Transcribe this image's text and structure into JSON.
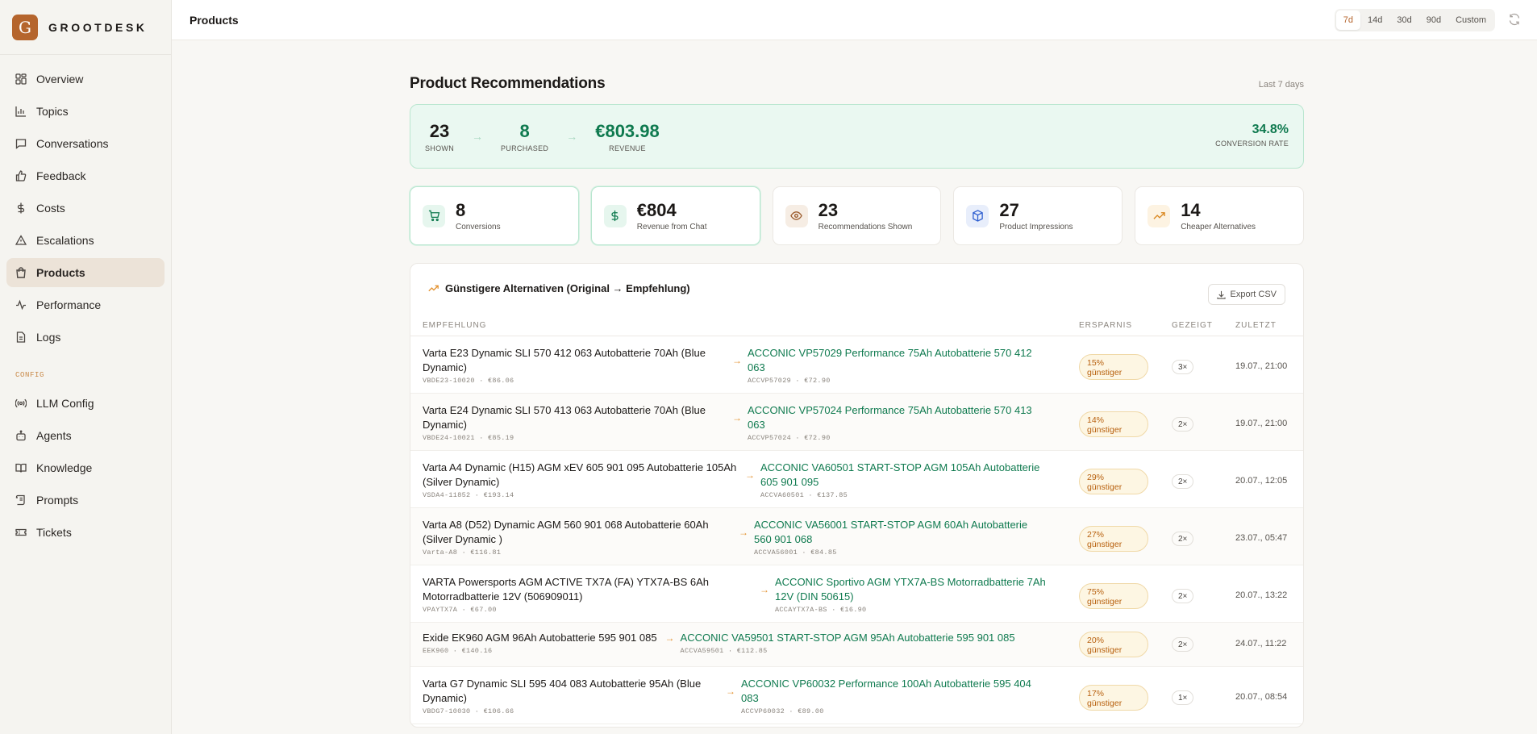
{
  "brand": {
    "logo_letter": "G",
    "name": "GROOTDESK"
  },
  "nav": {
    "items": [
      {
        "label": "Overview",
        "icon": "grid-icon"
      },
      {
        "label": "Topics",
        "icon": "bar-chart-icon"
      },
      {
        "label": "Conversations",
        "icon": "message-icon"
      },
      {
        "label": "Feedback",
        "icon": "thumbs-up-icon"
      },
      {
        "label": "Costs",
        "icon": "dollar-icon"
      },
      {
        "label": "Escalations",
        "icon": "warning-icon"
      },
      {
        "label": "Products",
        "icon": "bag-icon",
        "active": true
      },
      {
        "label": "Performance",
        "icon": "activity-icon"
      },
      {
        "label": "Logs",
        "icon": "file-icon"
      }
    ],
    "config_label": "CONFIG",
    "config_items": [
      {
        "label": "LLM Config",
        "icon": "radio-icon"
      },
      {
        "label": "Agents",
        "icon": "bot-icon"
      },
      {
        "label": "Knowledge",
        "icon": "book-icon"
      },
      {
        "label": "Prompts",
        "icon": "scroll-icon"
      },
      {
        "label": "Tickets",
        "icon": "ticket-icon"
      }
    ]
  },
  "topbar": {
    "title": "Products",
    "ranges": [
      "7d",
      "14d",
      "30d",
      "90d",
      "Custom"
    ],
    "active_range": "7d"
  },
  "page": {
    "title": "Product Recommendations",
    "range_label": "Last 7 days"
  },
  "funnel": {
    "shown": {
      "value": "23",
      "label": "SHOWN"
    },
    "purchased": {
      "value": "8",
      "label": "PURCHASED"
    },
    "revenue": {
      "value": "€803.98",
      "label": "REVENUE"
    },
    "conversion": {
      "value": "34.8%",
      "label": "CONVERSION RATE"
    }
  },
  "kpis": [
    {
      "value": "8",
      "label": "Conversions",
      "icon": "cart-icon",
      "color": "#0f7a4f",
      "bg": "#e6f6ee",
      "highlight": true
    },
    {
      "value": "€804",
      "label": "Revenue from Chat",
      "icon": "dollar-icon",
      "color": "#0f7a4f",
      "bg": "#e6f6ee",
      "highlight": true
    },
    {
      "value": "23",
      "label": "Recommendations Shown",
      "icon": "eye-icon",
      "color": "#9a5a2b",
      "bg": "#f6ede4",
      "highlight": false
    },
    {
      "value": "27",
      "label": "Product Impressions",
      "icon": "box-icon",
      "color": "#2f5fd0",
      "bg": "#e8eefb",
      "highlight": false
    },
    {
      "value": "14",
      "label": "Cheaper Alternatives",
      "icon": "trend-icon",
      "color": "#d9861d",
      "bg": "#fdf3e2",
      "highlight": false
    }
  ],
  "alternatives": {
    "title": "Günstigere Alternativen (Original → Empfehlung)",
    "export_label": "Export CSV",
    "columns": [
      "EMPFEHLUNG",
      "ERSPARNIS",
      "GEZEIGT",
      "ZULETZT"
    ],
    "rows": [
      {
        "orig": "Varta E23 Dynamic SLI 570 412 063 Autobatterie 70Ah (Blue Dynamic)",
        "orig_sub": "VBDE23-10020 · €86.06",
        "rec": "ACCONIC VP57029 Performance 75Ah Autobatterie 570 412 063",
        "rec_sub": "ACCVP57029 · €72.90",
        "pct": "15%",
        "word": "günstiger",
        "seen": "3×",
        "last": "19.07., 21:00"
      },
      {
        "orig": "Varta E24 Dynamic SLI 570 413 063 Autobatterie 70Ah (Blue Dynamic)",
        "orig_sub": "VBDE24-10021 · €85.19",
        "rec": "ACCONIC VP57024 Performance 75Ah Autobatterie 570 413 063",
        "rec_sub": "ACCVP57024 · €72.90",
        "pct": "14%",
        "word": "günstiger",
        "seen": "2×",
        "last": "19.07., 21:00"
      },
      {
        "orig": "Varta A4 Dynamic (H15) AGM xEV 605 901 095 Autobatterie 105Ah (Silver Dynamic)",
        "orig_sub": "VSDA4-11852 · €193.14",
        "rec": "ACCONIC VA60501 START-STOP AGM 105Ah Autobatterie 605 901 095",
        "rec_sub": "ACCVA60501 · €137.85",
        "pct": "29%",
        "word": "günstiger",
        "seen": "2×",
        "last": "20.07., 12:05"
      },
      {
        "orig": "Varta A8 (D52) Dynamic AGM 560 901 068 Autobatterie 60Ah (Silver Dynamic )",
        "orig_sub": "Varta-A8 · €116.81",
        "rec": "ACCONIC VA56001 START-STOP AGM 60Ah Autobatterie 560 901 068",
        "rec_sub": "ACCVA56001 · €84.85",
        "pct": "27%",
        "word": "günstiger",
        "seen": "2×",
        "last": "23.07., 05:47"
      },
      {
        "orig": "VARTA Powersports AGM ACTIVE TX7A (FA) YTX7A-BS 6Ah Motorradbatterie 12V (506909011)",
        "orig_sub": "VPAYTX7A · €67.00",
        "rec": "ACCONIC Sportivo AGM YTX7A-BS Motorradbatterie 7Ah 12V (DIN 50615)",
        "rec_sub": "ACCAYTX7A-BS · €16.90",
        "pct": "75%",
        "word": "günstiger",
        "seen": "2×",
        "last": "20.07., 13:22"
      },
      {
        "orig": "Exide EK960 AGM 96Ah Autobatterie 595 901 085",
        "orig_sub": "EEK960 · €140.16",
        "rec": "ACCONIC VA59501 START-STOP AGM 95Ah Autobatterie 595 901 085",
        "rec_sub": "ACCVA59501 · €112.85",
        "pct": "20%",
        "word": "günstiger",
        "seen": "2×",
        "last": "24.07., 11:22"
      },
      {
        "orig": "Varta G7 Dynamic SLI 595 404 083 Autobatterie 95Ah (Blue Dynamic)",
        "orig_sub": "VBDG7-10030 · €106.66",
        "rec": "ACCONIC VP60032 Performance 100Ah Autobatterie 595 404 083",
        "rec_sub": "ACCVP60032 · €89.00",
        "pct": "17%",
        "word": "günstiger",
        "seen": "1×",
        "last": "20.07., 08:54"
      }
    ]
  }
}
